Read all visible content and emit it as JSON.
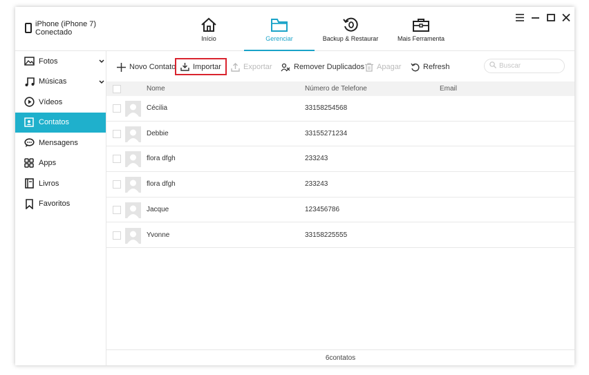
{
  "device": {
    "name": "iPhone (iPhone 7)",
    "status": "Conectado"
  },
  "nav": {
    "tabs": [
      {
        "label": "Início",
        "icon": "home-icon"
      },
      {
        "label": "Gerenciar",
        "icon": "folder-icon",
        "active": true
      },
      {
        "label": "Backup & Restaurar",
        "icon": "backup-restore-icon"
      },
      {
        "label": "Mais Ferramenta",
        "icon": "toolbox-icon"
      }
    ]
  },
  "window_controls": [
    "menu-icon",
    "minimize-icon",
    "maximize-icon",
    "close-icon"
  ],
  "sidebar": {
    "items": [
      {
        "label": "Fotos",
        "icon": "photo-icon",
        "expandable": true
      },
      {
        "label": "Músicas",
        "icon": "music-icon",
        "expandable": true
      },
      {
        "label": "Vídeos",
        "icon": "play-icon"
      },
      {
        "label": "Contatos",
        "icon": "contact-icon",
        "active": true
      },
      {
        "label": "Mensagens",
        "icon": "message-icon"
      },
      {
        "label": "Apps",
        "icon": "apps-icon"
      },
      {
        "label": "Livros",
        "icon": "book-icon"
      },
      {
        "label": "Favoritos",
        "icon": "bookmark-icon"
      }
    ]
  },
  "toolbar": {
    "new_contact": "Novo Contato",
    "import": "Importar",
    "export": "Exportar",
    "remove_duplicates": "Remover Duplicados",
    "delete": "Apagar",
    "refresh": "Refresh",
    "search_placeholder": "Buscar"
  },
  "table": {
    "columns": [
      "Nome",
      "Número de Telefone",
      "Email"
    ],
    "rows": [
      {
        "name": "Cécilia",
        "phone": "33158254568",
        "email": ""
      },
      {
        "name": "Debbie",
        "phone": "33155271234",
        "email": ""
      },
      {
        "name": "flora dfgh",
        "phone": "233243",
        "email": ""
      },
      {
        "name": "flora dfgh",
        "phone": "233243",
        "email": ""
      },
      {
        "name": "Jacque",
        "phone": "123456786",
        "email": ""
      },
      {
        "name": "Yvonne",
        "phone": "33158225555",
        "email": ""
      }
    ]
  },
  "footer": {
    "count": "6contatos"
  },
  "colors": {
    "accent": "#1aa3c8",
    "sidebar_active": "#1fb0cc",
    "highlight_border": "#d9232e"
  }
}
